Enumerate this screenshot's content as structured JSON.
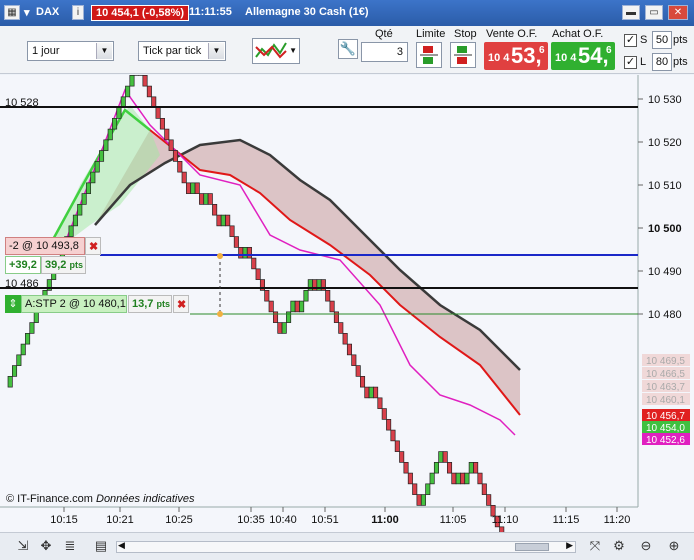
{
  "window": {
    "instrument": "DAX",
    "price_badge": "10 454,1 (-0,58%)",
    "time": "11:11:55",
    "title": "Allemagne 30 Cash (1€)"
  },
  "toolbar": {
    "period_select": "1 jour",
    "tick_select": "Tick par tick",
    "qty_label": "Qté",
    "qty_value": "3",
    "limit_label": "Limite",
    "stop_label": "Stop",
    "sell_label": "Vente O.F.",
    "sell_small": "10 4",
    "sell_big": "53,",
    "sell_sup": "6",
    "buy_label": "Achat O.F.",
    "buy_small": "10 4",
    "buy_big": "54,",
    "buy_sup": "6",
    "s_label": "S",
    "s_value": "50",
    "s_unit": "pts",
    "l_label": "L",
    "l_value": "80",
    "l_unit": "pts"
  },
  "chart_data": {
    "type": "renko",
    "y_ticks": [
      "10 530",
      "10 520",
      "10 510",
      "10 500",
      "10 490",
      "10 480"
    ],
    "x_ticks": [
      "10:15",
      "10:21",
      "10:25",
      "10:35",
      "10:40",
      "10:51",
      "11:00",
      "11:05",
      "11:10",
      "11:15",
      "11:20"
    ],
    "level_label": "10 528",
    "level_label_2": "10 486",
    "right_tags": [
      "10 469,5",
      "10 466,5",
      "10 463,7",
      "10 460,1",
      "10 456,7",
      "10 454,0",
      "10 452,6"
    ],
    "copyright": "© IT-Finance.com",
    "disclaimer": "Données indicatives",
    "colors": {
      "up": "#45c040",
      "down": "#d8404a",
      "ema_fast": "#e020c0",
      "ema_mid": "#e01818",
      "ema_slow": "#3a3a3a",
      "green_ema": "#40d040"
    }
  },
  "orders": {
    "position_label": "-2 @ 10 493,8",
    "pnl_value": "+39,2",
    "pnl_pts": "39,2",
    "pnl_unit": "pts",
    "stop_order_label": "A:STP  2 @ 10 480,1",
    "stop_pts": "13,7",
    "stop_unit": "pts"
  }
}
